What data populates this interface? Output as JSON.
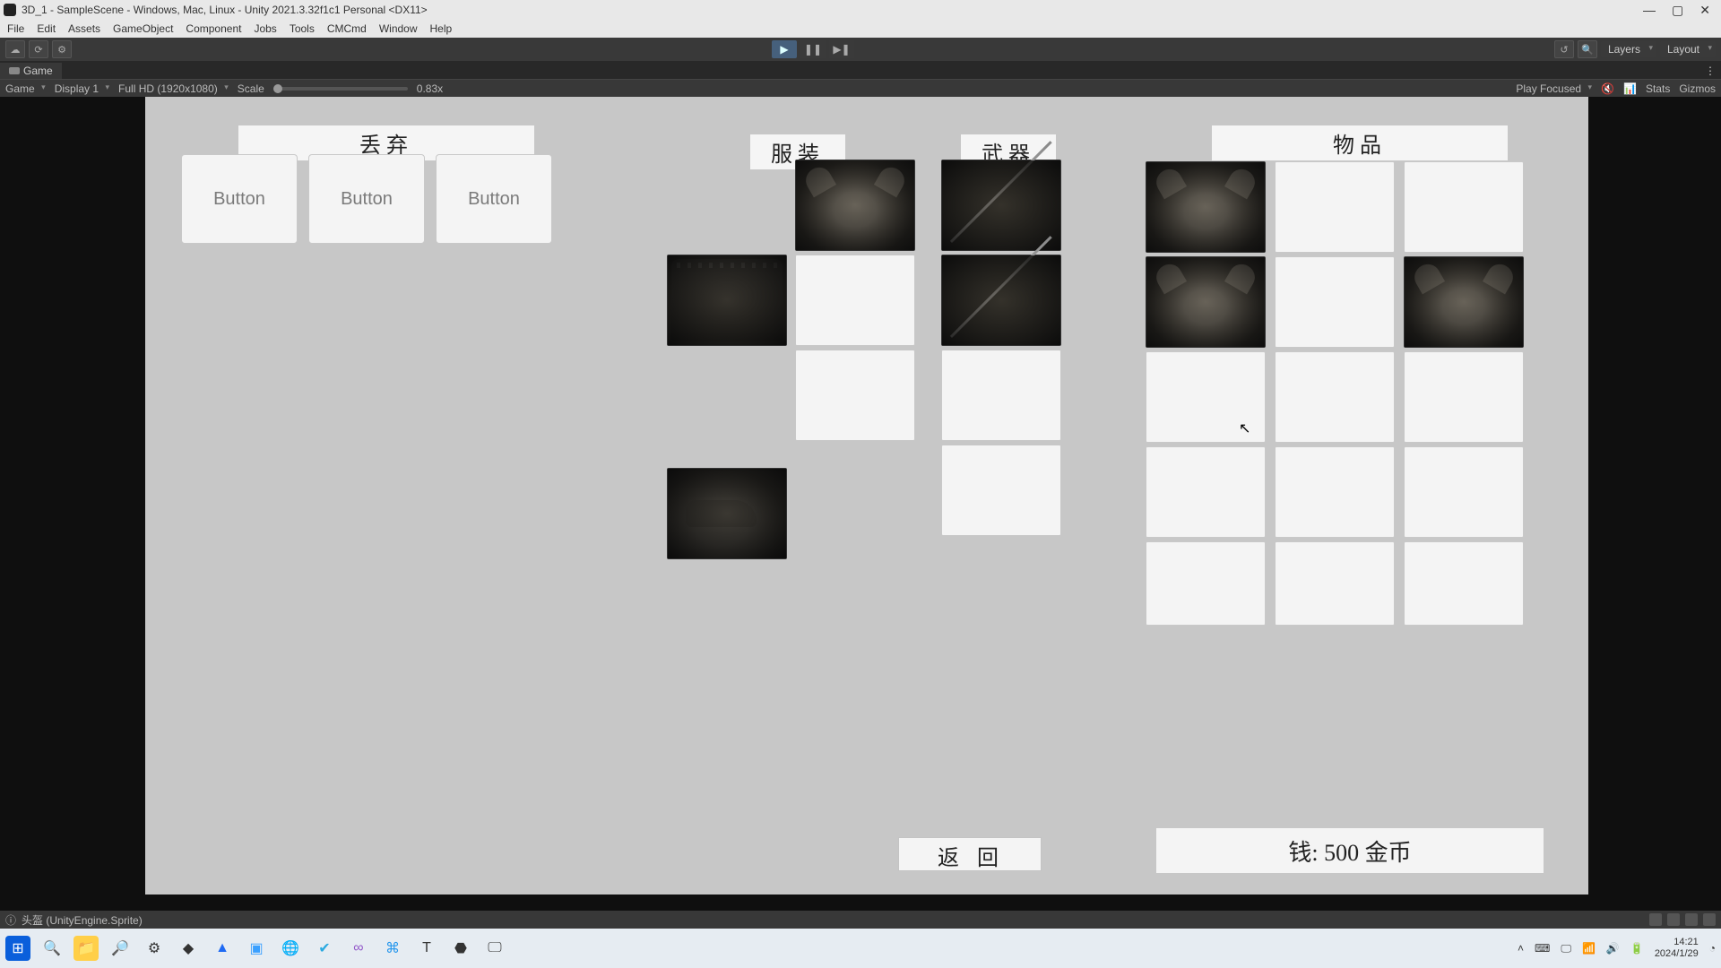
{
  "window": {
    "title": "3D_1 - SampleScene - Windows, Mac, Linux - Unity 2021.3.32f1c1 Personal <DX11>"
  },
  "menubar": [
    "File",
    "Edit",
    "Assets",
    "GameObject",
    "Component",
    "Jobs",
    "Tools",
    "CMCmd",
    "Window",
    "Help"
  ],
  "toolbar": {
    "layers": "Layers",
    "layout": "Layout"
  },
  "gameTab": {
    "label": "Game"
  },
  "gameHeader": {
    "mode": "Game",
    "display": "Display 1",
    "resolution": "Full HD (1920x1080)",
    "scaleLabel": "Scale",
    "scaleValue": "0.83x",
    "playMode": "Play Focused",
    "stats": "Stats",
    "gizmos": "Gizmos"
  },
  "panels": {
    "discard": "丢弃",
    "armor": "服装",
    "weapon": "武器",
    "items": "物品"
  },
  "discardButtons": [
    "Button",
    "Button",
    "Button"
  ],
  "returnLabel": "返回",
  "moneyLabel": "钱: 500 金币",
  "statusbar": "头盔 (UnityEngine.Sprite)",
  "taskbar": {
    "time": "14:21",
    "date": "2024/1/29"
  }
}
